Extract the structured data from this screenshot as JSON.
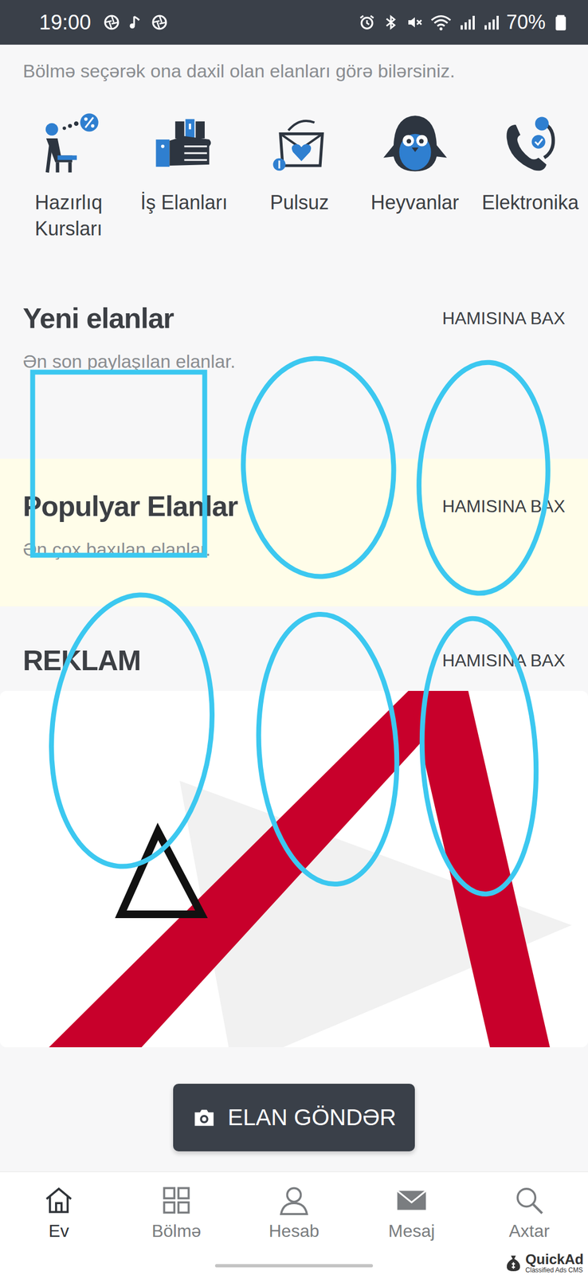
{
  "status_bar": {
    "time": "19:00",
    "battery": "70%"
  },
  "intro": "Bölmə seçərək ona daxil olan elanları görə bilərsiniz.",
  "categories": [
    {
      "label": "Hazırlıq Kursları",
      "kind": "courses"
    },
    {
      "label": "İş Elanları",
      "kind": "jobs"
    },
    {
      "label": "Pulsuz",
      "kind": "free"
    },
    {
      "label": "Heyvanlar",
      "kind": "animals"
    },
    {
      "label": "Elektronika",
      "kind": "electronics"
    }
  ],
  "sections": [
    {
      "title": "Yeni elanlar",
      "link": "HAMISINA BAX",
      "subtitle": "Ən son paylaşılan elanlar.",
      "highlighted": false
    },
    {
      "title": "Populyar Elanlar",
      "link": "HAMISINA BAX",
      "subtitle": "Ən çox baxılan elanlar.",
      "highlighted": true
    }
  ],
  "ad_section": {
    "title": "REKLAM",
    "link": "HAMISINA BAX"
  },
  "post_button": "ELAN GÖNDƏR",
  "nav": [
    {
      "label": "Ev",
      "kind": "home",
      "selected": true
    },
    {
      "label": "Bölmə",
      "kind": "sections",
      "selected": false
    },
    {
      "label": "Hesab",
      "kind": "account",
      "selected": false
    },
    {
      "label": "Mesaj",
      "kind": "messages",
      "selected": false
    },
    {
      "label": "Axtar",
      "kind": "search",
      "selected": false
    }
  ],
  "watermark": {
    "name": "QuickAd",
    "tagline": "Classified Ads CMS"
  },
  "annotations": [
    {
      "kind": "rect"
    },
    {
      "kind": "loop"
    },
    {
      "kind": "loop"
    },
    {
      "kind": "loop"
    },
    {
      "kind": "loop"
    },
    {
      "kind": "loop"
    }
  ]
}
